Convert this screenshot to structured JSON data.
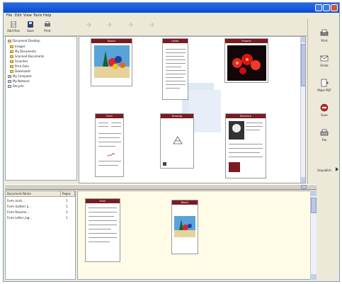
{
  "menu": [
    "File",
    "Edit",
    "View",
    "Tools",
    "Help"
  ],
  "toolbar": [
    {
      "label": "Add Files",
      "icon": "add-files-icon",
      "enabled": true
    },
    {
      "label": "Save",
      "icon": "save-icon",
      "enabled": true
    },
    {
      "label": "Print",
      "icon": "print-icon",
      "enabled": true
    },
    {
      "label": "",
      "icon": "arrow-icon",
      "enabled": false
    },
    {
      "label": "",
      "icon": "arrow-icon",
      "enabled": false
    },
    {
      "label": "",
      "icon": "arrow-icon",
      "enabled": false
    },
    {
      "label": "",
      "icon": "arrow-icon",
      "enabled": false
    }
  ],
  "folders": [
    "Document Desktop",
    "Images",
    "My Documents",
    "Scanned Documents",
    "Favorites",
    "Print Outs",
    "Downloads",
    "My Computer",
    "My Network",
    "Recycle"
  ],
  "preview_docs": [
    {
      "caption": "Beach"
    },
    {
      "caption": "Letter"
    },
    {
      "caption": "Flowers"
    },
    {
      "caption": "Form"
    },
    {
      "caption": "Drawing"
    },
    {
      "caption": "Brochure"
    }
  ],
  "right_tools": [
    {
      "label": "Print",
      "icon": "printer-icon"
    },
    {
      "label": "Email",
      "icon": "email-icon"
    },
    {
      "label": "Make PDF",
      "icon": "document-plus-icon"
    },
    {
      "label": "Scan",
      "icon": "scan-icon"
    },
    {
      "label": "Fax",
      "icon": "fax-icon"
    },
    {
      "label": "Unpublish",
      "icon": "chevron-icon"
    }
  ],
  "files": {
    "col_name": "Document Name",
    "col_pages": "Pages",
    "rows": [
      {
        "name": "Form (unt)...",
        "pages": "1"
      },
      {
        "name": "Form (Letter) p...",
        "pages": "1"
      },
      {
        "name": "Form Resume...",
        "pages": "1"
      },
      {
        "name": "Form Letter_log...",
        "pages": "1"
      }
    ]
  },
  "tray_docs": [
    {
      "caption": "Form"
    },
    {
      "caption": "Beach"
    }
  ],
  "colors": {
    "caption_bar": "#7a1b22",
    "tray_bg": "#fffbe6",
    "title_blue": "#0a4bcf"
  }
}
